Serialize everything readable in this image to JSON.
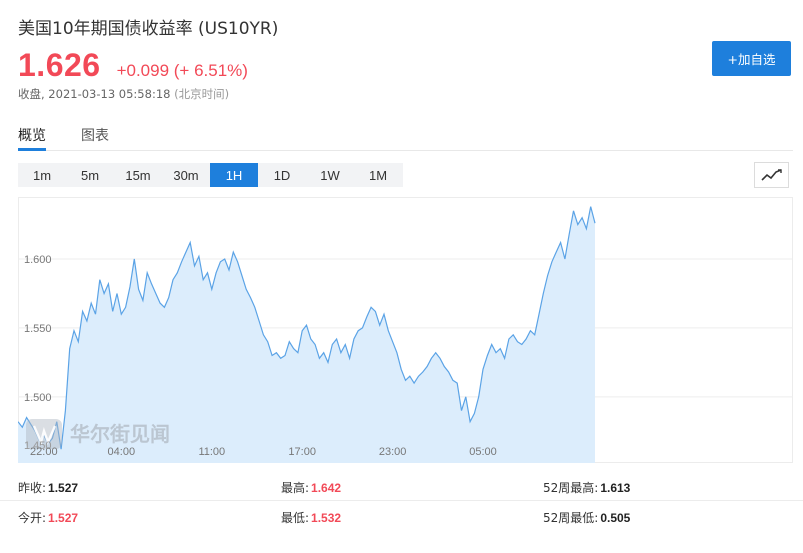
{
  "header": {
    "title": "美国10年期国债收益率 (US10YR)",
    "price": "1.626",
    "change": "+0.099 (+ 6.51%)",
    "status": "收盘, 2021-03-13 05:58:18",
    "timezone": "(北京时间)",
    "follow_label": "+加自选"
  },
  "tabs": [
    {
      "label": "概览",
      "active": true
    },
    {
      "label": "图表",
      "active": false
    }
  ],
  "ranges": [
    {
      "label": "1m",
      "active": false
    },
    {
      "label": "5m",
      "active": false
    },
    {
      "label": "15m",
      "active": false
    },
    {
      "label": "30m",
      "active": false
    },
    {
      "label": "1H",
      "active": true
    },
    {
      "label": "1D",
      "active": false
    },
    {
      "label": "1W",
      "active": false
    },
    {
      "label": "1M",
      "active": false
    }
  ],
  "watermark": "华尔街见闻",
  "colors": {
    "accent": "#1e7fdc",
    "up": "#f24957",
    "line": "#5ba3e6",
    "area": "#dcedfc"
  },
  "chart_data": {
    "type": "area",
    "x_tick_labels": [
      "22:00",
      "04:00",
      "11:00",
      "17:00",
      "23:00",
      "05:00"
    ],
    "x_tick_index": [
      6,
      24,
      45,
      66,
      87,
      108
    ],
    "y_ticks": [
      "1.600",
      "1.550",
      "1.500"
    ],
    "y_tick_values": [
      1.6,
      1.55,
      1.5
    ],
    "partial_y_label": "1.450",
    "ylim": [
      1.452,
      1.645
    ],
    "x_count": 135,
    "grid": true,
    "values": [
      1.482,
      1.478,
      1.485,
      1.48,
      1.475,
      1.468,
      1.472,
      1.466,
      1.47,
      1.482,
      1.462,
      1.49,
      1.535,
      1.548,
      1.54,
      1.562,
      1.555,
      1.568,
      1.56,
      1.585,
      1.575,
      1.582,
      1.562,
      1.575,
      1.56,
      1.565,
      1.58,
      1.6,
      1.578,
      1.57,
      1.59,
      1.582,
      1.575,
      1.568,
      1.565,
      1.572,
      1.585,
      1.59,
      1.598,
      1.605,
      1.612,
      1.595,
      1.602,
      1.585,
      1.59,
      1.578,
      1.59,
      1.598,
      1.6,
      1.592,
      1.605,
      1.598,
      1.588,
      1.578,
      1.572,
      1.565,
      1.555,
      1.545,
      1.54,
      1.53,
      1.532,
      1.528,
      1.53,
      1.54,
      1.535,
      1.532,
      1.548,
      1.552,
      1.542,
      1.538,
      1.528,
      1.532,
      1.525,
      1.538,
      1.542,
      1.532,
      1.538,
      1.528,
      1.542,
      1.548,
      1.55,
      1.558,
      1.565,
      1.562,
      1.552,
      1.56,
      1.548,
      1.54,
      1.532,
      1.52,
      1.512,
      1.515,
      1.51,
      1.515,
      1.518,
      1.522,
      1.528,
      1.532,
      1.528,
      1.522,
      1.518,
      1.512,
      1.51,
      1.49,
      1.5,
      1.482,
      1.488,
      1.5,
      1.52,
      1.53,
      1.538,
      1.532,
      1.535,
      1.528,
      1.542,
      1.545,
      1.54,
      1.538,
      1.542,
      1.548,
      1.545,
      1.56,
      1.575,
      1.588,
      1.598,
      1.605,
      1.612,
      1.6,
      1.618,
      1.635,
      1.625,
      1.63,
      1.622,
      1.638,
      1.626
    ]
  },
  "stats": {
    "row1": [
      {
        "label": "昨收:",
        "value": "1.527",
        "tone": "dark"
      },
      {
        "label": "最高:",
        "value": "1.642",
        "tone": "red"
      },
      {
        "label": "52周最高:",
        "value": "1.613",
        "tone": "dark"
      }
    ],
    "row2": [
      {
        "label": "今开:",
        "value": "1.527",
        "tone": "red"
      },
      {
        "label": "最低:",
        "value": "1.532",
        "tone": "red"
      },
      {
        "label": "52周最低:",
        "value": "0.505",
        "tone": "dark"
      }
    ]
  }
}
